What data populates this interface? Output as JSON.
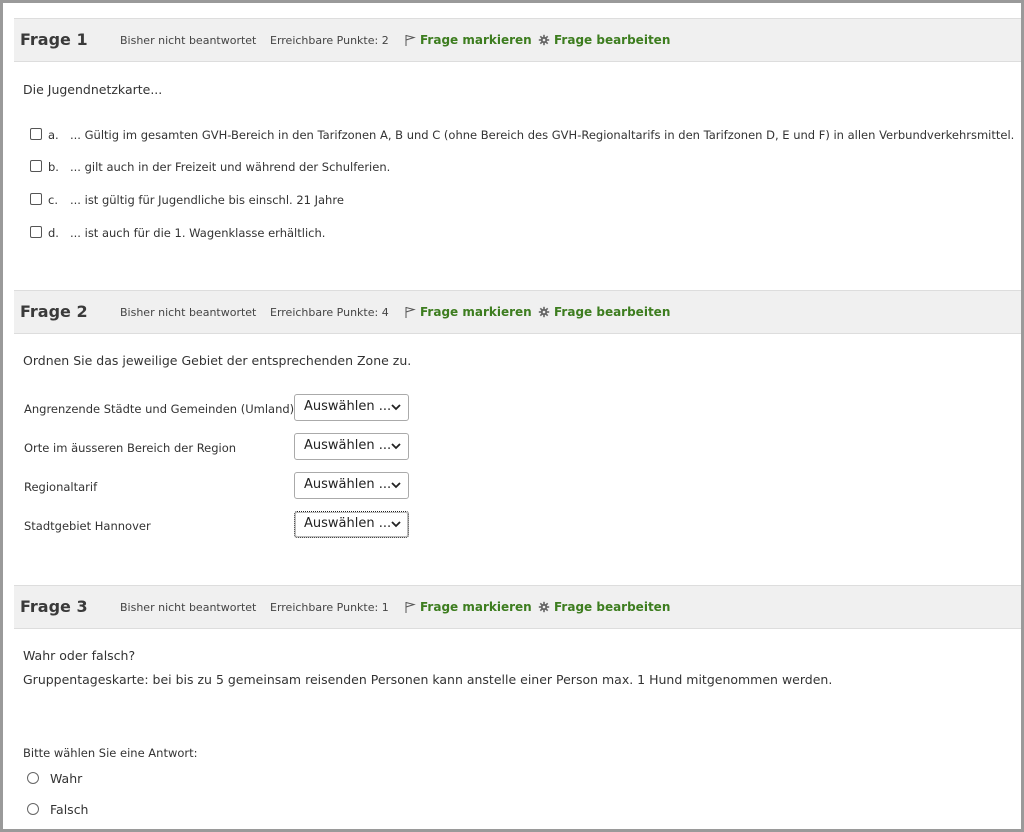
{
  "questions": [
    {
      "title": "Frage 1",
      "state": "Bisher nicht beantwortet",
      "points": "Erreichbare Punkte: 2",
      "flag_label": "Frage markieren",
      "edit_label": "Frage bearbeiten",
      "prompt": "Die Jugendnetzkarte...",
      "options": [
        {
          "letter": "a.",
          "text": "... Gültig im gesamten GVH-Bereich in den Tarifzonen A, B und C (ohne Bereich des GVH-Regionaltarifs in den Tarifzonen D, E und F) in allen Verbundverkehrsmittel."
        },
        {
          "letter": "b.",
          "text": "... gilt auch in der Freizeit und während der Schulferien."
        },
        {
          "letter": "c.",
          "text": "... ist gültig für Jugendliche bis einschl. 21 Jahre"
        },
        {
          "letter": "d.",
          "text": "... ist auch für die 1. Wagenklasse erhältlich."
        }
      ]
    },
    {
      "title": "Frage 2",
      "state": "Bisher nicht beantwortet",
      "points": "Erreichbare Punkte: 4",
      "flag_label": "Frage markieren",
      "edit_label": "Frage bearbeiten",
      "prompt": "Ordnen Sie das jeweilige Gebiet der entsprechenden Zone zu.",
      "rows": [
        {
          "label": "Angrenzende Städte und Gemeinden (Umland)",
          "select": "Auswählen ..."
        },
        {
          "label": "Orte im äusseren Bereich der Region",
          "select": "Auswählen ..."
        },
        {
          "label": "Regionaltarif",
          "select": "Auswählen ..."
        },
        {
          "label": "Stadtgebiet Hannover",
          "select": "Auswählen ..."
        }
      ]
    },
    {
      "title": "Frage 3",
      "state": "Bisher nicht beantwortet",
      "points": "Erreichbare Punkte: 1",
      "flag_label": "Frage markieren",
      "edit_label": "Frage bearbeiten",
      "prompt_line1": "Wahr oder falsch?",
      "prompt_line2": "Gruppentageskarte: bei bis zu 5 gemeinsam reisenden Personen kann anstelle einer Person max. 1 Hund mitgenommen werden.",
      "answer_label": "Bitte wählen Sie eine Antwort:",
      "choices": [
        "Wahr",
        "Falsch"
      ]
    }
  ],
  "colors": {
    "accent_green": "#3d7d1f",
    "header_bg": "#f0f0f0"
  },
  "icons": {
    "flag": "flag-icon",
    "edit": "gear-icon",
    "dropdown": "chevron-down-icon"
  }
}
